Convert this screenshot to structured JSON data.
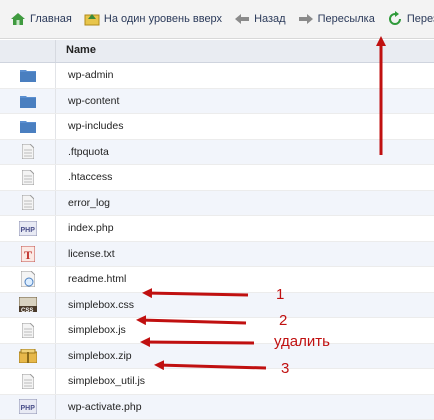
{
  "toolbar": {
    "home_label": "Главная",
    "up_label": "На один уровень вверх",
    "back_label": "Назад",
    "forward_label": "Пересылка",
    "reload_label": "Перезагрузка"
  },
  "table": {
    "name_header": "Name"
  },
  "files": [
    {
      "name": "wp-admin",
      "icon": "folder-icon"
    },
    {
      "name": "wp-content",
      "icon": "folder-icon"
    },
    {
      "name": "wp-includes",
      "icon": "folder-icon"
    },
    {
      "name": ".ftpquota",
      "icon": "text-file-icon"
    },
    {
      "name": ".htaccess",
      "icon": "text-file-icon"
    },
    {
      "name": "error_log",
      "icon": "text-file-icon"
    },
    {
      "name": "index.php",
      "icon": "php-file-icon"
    },
    {
      "name": "license.txt",
      "icon": "txt-file-icon"
    },
    {
      "name": "readme.html",
      "icon": "html-file-icon"
    },
    {
      "name": "simplebox.css",
      "icon": "css-file-icon"
    },
    {
      "name": "simplebox.js",
      "icon": "text-file-icon"
    },
    {
      "name": "simplebox.zip",
      "icon": "zip-file-icon"
    },
    {
      "name": "simplebox_util.js",
      "icon": "text-file-icon"
    },
    {
      "name": "wp-activate.php",
      "icon": "php-file-icon"
    }
  ],
  "annotations": {
    "label_1": "1",
    "label_2": "2",
    "label_delete": "удалить",
    "label_3": "3"
  },
  "colors": {
    "annotation_red": "#c01010",
    "folder_blue": "#5b8fd0"
  }
}
